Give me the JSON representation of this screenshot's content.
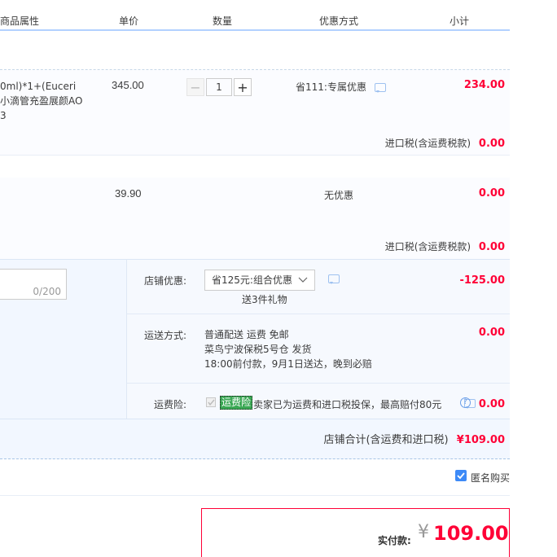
{
  "header": {
    "product_attr": "商品属性",
    "unit_price": "单价",
    "quantity": "数量",
    "discount": "优惠方式",
    "subtotal": "小计"
  },
  "item1": {
    "name_line1": "0ml)*1+(Euceri",
    "name_line2": "小滴管充盈展颜AO",
    "name_line3": "3",
    "price": "345.00",
    "qty": "1",
    "discount": "省111:专属优惠",
    "subtotal": "234.00",
    "tax_label": "进口税(含运费税款)",
    "tax_value": "0.00"
  },
  "item2": {
    "price": "39.90",
    "discount": "无优惠",
    "subtotal": "0.00",
    "tax_label": "进口税(含运费税款)",
    "tax_value": "0.00"
  },
  "note": {
    "counter": "0/200"
  },
  "store_discount": {
    "label": "店铺优惠:",
    "selected": "省125元:组合优惠",
    "gift": "送3件礼物",
    "value": "-125.00"
  },
  "shipping": {
    "label": "运送方式:",
    "line1": "普通配送 运费 免邮",
    "line2": "菜鸟宁波保税5号仓  发货",
    "line3": "18:00前付款，9月1日送达，晚到必赔",
    "value": "0.00"
  },
  "insurance": {
    "label": "运费险:",
    "badge": "运费险",
    "text": "卖家已为运费和进口税投保，最高赔付80元",
    "value": "0.00"
  },
  "store_total": {
    "label": "店铺合计(含运费和进口税)",
    "value": "¥109.00"
  },
  "anonymous": {
    "label": "匿名购买"
  },
  "payment": {
    "label": "实付款:",
    "currency": "¥",
    "value": "109.00"
  },
  "colors": {
    "accent_red": "#ff0036",
    "header_line": "#b2d1ff",
    "band_bg": "#f2f7ff",
    "badge_green": "#5cb85c",
    "checkbox_blue": "#3d8af7"
  }
}
